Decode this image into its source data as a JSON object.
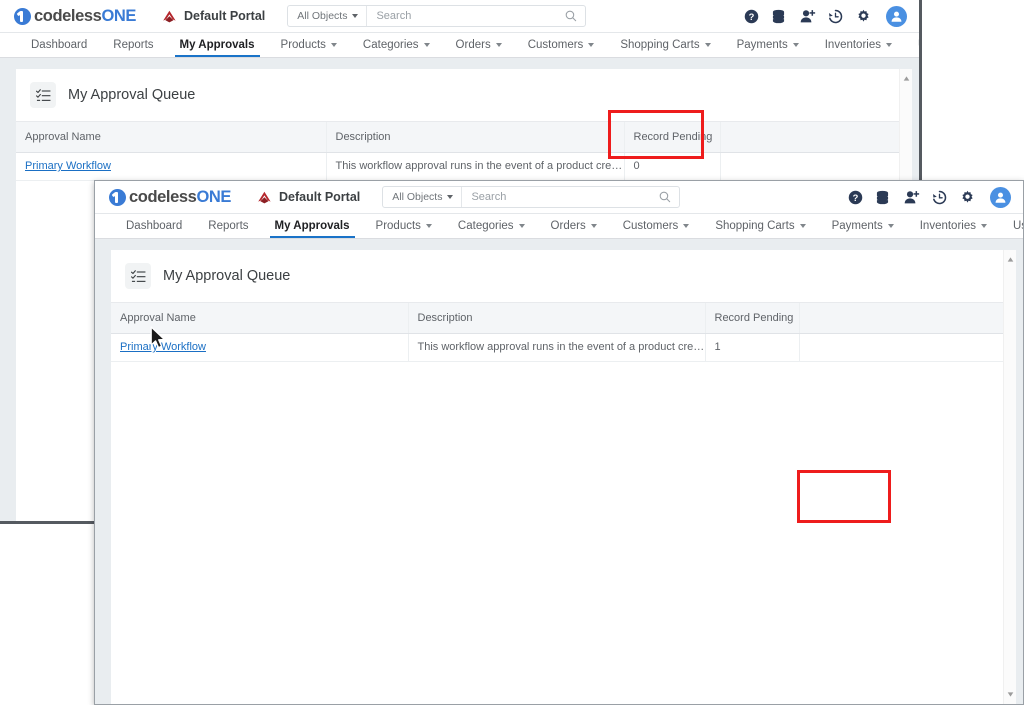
{
  "app": {
    "logo": {
      "part1": "codeless",
      "part2": "ONE",
      "icon": "codelessone-logo-icon"
    },
    "portal": {
      "label": "Default Portal",
      "icon": "portal-logo-icon"
    },
    "search": {
      "scope_label": "All Objects",
      "placeholder": "Search",
      "icon": "search-icon"
    },
    "top_icons": [
      {
        "name": "help-icon",
        "glyph": "?"
      },
      {
        "name": "database-icon",
        "glyph": ""
      },
      {
        "name": "add-user-icon",
        "glyph": ""
      },
      {
        "name": "history-icon",
        "glyph": ""
      },
      {
        "name": "settings-gear-icon",
        "glyph": ""
      },
      {
        "name": "user-avatar",
        "glyph": ""
      }
    ],
    "nav_tabs": [
      {
        "label": "Dashboard",
        "has_caret": false,
        "active": false
      },
      {
        "label": "Reports",
        "has_caret": false,
        "active": false
      },
      {
        "label": "My Approvals",
        "has_caret": false,
        "active": true
      },
      {
        "label": "Products",
        "has_caret": true,
        "active": false
      },
      {
        "label": "Categories",
        "has_caret": true,
        "active": false
      },
      {
        "label": "Orders",
        "has_caret": true,
        "active": false
      },
      {
        "label": "Customers",
        "has_caret": true,
        "active": false
      },
      {
        "label": "Shopping Carts",
        "has_caret": true,
        "active": false
      },
      {
        "label": "Payments",
        "has_caret": true,
        "active": false
      },
      {
        "label": "Inventories",
        "has_caret": true,
        "active": false
      },
      {
        "label": "User Profiles",
        "has_caret": true,
        "active": false
      }
    ]
  },
  "page": {
    "card_title": "My Approval Queue",
    "card_icon": "task-list-icon",
    "columns": [
      "Approval Name",
      "Description",
      "Record Pending",
      ""
    ]
  },
  "window_back": {
    "rows": [
      {
        "approval_name": "Primary Workflow",
        "description": "This workflow approval runs in the event of a product created with v...",
        "record_pending": "0",
        "blank": ""
      }
    ]
  },
  "window_front": {
    "rows": [
      {
        "approval_name": "Primary Workflow",
        "description": "This workflow approval runs in the event of a product created with v...",
        "record_pending": "1",
        "blank": ""
      }
    ]
  },
  "annotations": {
    "highlight_color": "#ee1c1c",
    "back_box_target": "Record Pending",
    "front_box_target": "Record Pending"
  },
  "colors": {
    "brand_blue": "#3a7bd5",
    "link_blue": "#1a6fc4",
    "active_tab_underline": "#1a73c8",
    "portal_red": "#b5272d",
    "page_bg": "#e9edf0"
  }
}
